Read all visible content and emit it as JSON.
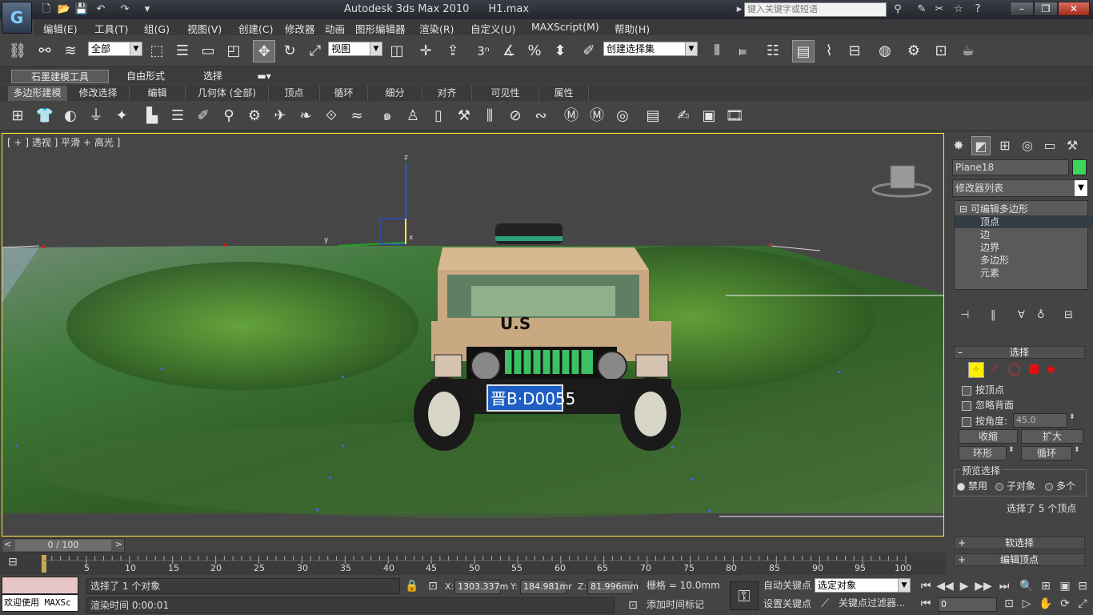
{
  "title_bar": {
    "app_name": "Autodesk 3ds Max  2010",
    "file_name": "H1.max",
    "search_placeholder": "键入关键字或短语"
  },
  "menu": [
    "编辑(E)",
    "工具(T)",
    "组(G)",
    "视图(V)",
    "创建(C)",
    "修改器",
    "动画",
    "图形编辑器",
    "渲染(R)",
    "自定义(U)",
    "MAXScript(M)",
    "帮助(H)"
  ],
  "toolbar": {
    "selection_filter": "全部",
    "reference_coord": "视图",
    "named_selection": "创建选择集",
    "snap_number": "3"
  },
  "ribbon": {
    "tabs": [
      "石墨建模工具",
      "自由形式",
      "选择"
    ],
    "subtabs": [
      "多边形建模",
      "修改选择",
      "编辑",
      "几何体 (全部)",
      "顶点",
      "循环",
      "细分",
      "对齐",
      "可见性",
      "属性"
    ]
  },
  "viewport": {
    "label": "[ + ] 透视 ] 平滑 + 高光 ]",
    "plate_text": "晋B·D0055",
    "hood_text": "U.S"
  },
  "command_panel": {
    "object_name": "Plane18",
    "modifier_list": "修改器列表",
    "stack": {
      "root": "可编辑多边形",
      "items": [
        "顶点",
        "边",
        "边界",
        "多边形",
        "元素"
      ],
      "selected_index": 0
    },
    "selection_rollout": {
      "title": "选择",
      "by_vertex": "按顶点",
      "ignore_backface": "忽略背面",
      "by_angle": "按角度:",
      "angle_value": "45.0",
      "shrink": "收缩",
      "grow": "扩大",
      "ring": "环形",
      "loop": "循环",
      "preview_title": "预览选择",
      "preview_options": [
        "禁用",
        "子对象",
        "多个"
      ],
      "preview_selected": 0,
      "status": "选择了 5 个顶点"
    },
    "soft_selection": "软选择",
    "edit_vertices": "编辑顶点"
  },
  "timeline": {
    "frame_display": "0 / 100",
    "ticks": [
      "5",
      "10",
      "15",
      "20",
      "25",
      "30",
      "35",
      "40",
      "45",
      "50",
      "55",
      "60",
      "65",
      "70",
      "75",
      "80",
      "85",
      "90",
      "95",
      "100"
    ]
  },
  "status_bar": {
    "welcome": "欢迎使用 MAXSc",
    "prompt": "选择了 1 个对象",
    "render_time": "渲染时间  0:00:01",
    "x": "1303.337m",
    "y": "184.981mr",
    "z": "81.996mm",
    "grid": "栅格 = 10.0mm",
    "add_time_tag": "添加时间标记",
    "auto_key": "自动关键点",
    "set_key": "设置关键点",
    "selected_object": "选定对象",
    "key_filters": "关键点过滤器...",
    "current_frame": "0"
  },
  "colors": {
    "accent_yellow": "#ffeb3b",
    "object_color": "#3cd65a",
    "background": "#444444"
  }
}
